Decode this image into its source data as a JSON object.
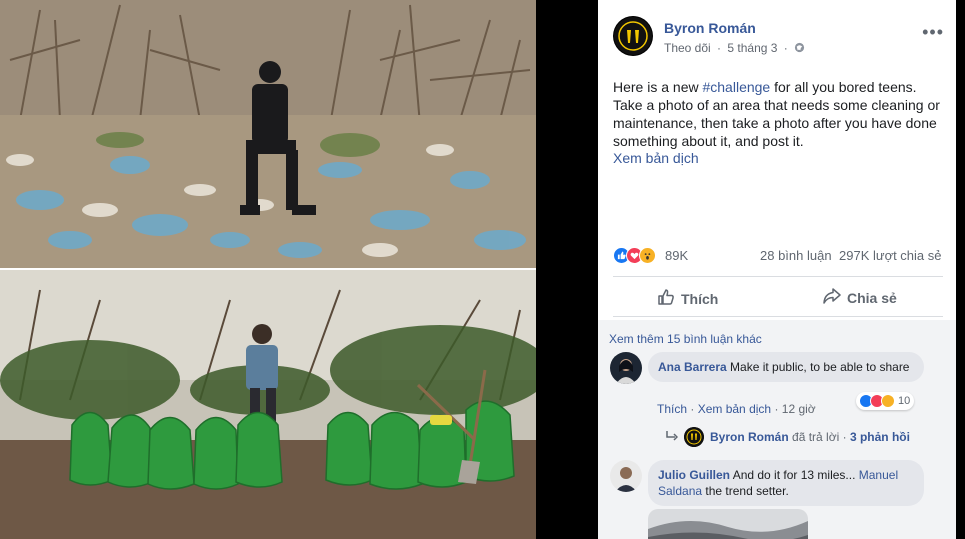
{
  "post": {
    "author": "Byron Román",
    "follow_label": "Theo dõi",
    "date": "5 tháng 3",
    "more_icon": "ellipsis-icon",
    "text_before": "Here is a new ",
    "hashtag": "#challenge",
    "text_after": " for all you bored teens. Take a photo of an area that needs some cleaning or maintenance, then take a photo after you have done something about it, and post it.",
    "translate_label": "Xem bản dịch",
    "reaction_count": "89K",
    "comment_count": "28 bình luận",
    "share_count": "297K lượt chia sẻ",
    "like_label": "Thích",
    "share_label": "Chia sẻ"
  },
  "comments": {
    "more_label": "Xem thêm 15 bình luận khác",
    "items": [
      {
        "name": "Ana Barrera",
        "text": "Make it public, to be able to share",
        "like_label": "Thích",
        "translate_label": "Xem bản dịch",
        "time": "12 giờ",
        "reaction_count": "10",
        "reply_author": "Byron Román",
        "reply_text": "đã trả lời",
        "reply_count": "3 phản hồi"
      },
      {
        "name": "Julio Guillen",
        "text": "And do it for 13 miles...",
        "mention": "Manuel Saldana",
        "text_after": "the trend setter."
      }
    ]
  },
  "colors": {
    "link_blue": "#385898",
    "like_blue": "#1877f2",
    "love_red": "#f33e58",
    "wow_yellow": "#f7b125",
    "bag_green": "#2e9a3e"
  }
}
